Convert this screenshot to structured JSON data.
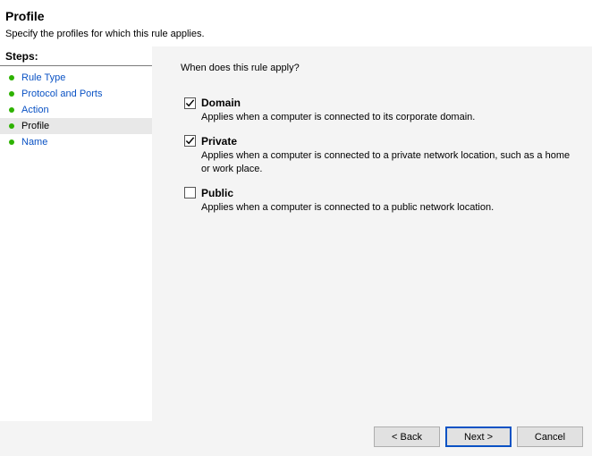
{
  "header": {
    "title": "Profile",
    "subtitle": "Specify the profiles for which this rule applies."
  },
  "sidebar": {
    "heading": "Steps:",
    "items": [
      {
        "label": "Rule Type",
        "current": false
      },
      {
        "label": "Protocol and Ports",
        "current": false
      },
      {
        "label": "Action",
        "current": false
      },
      {
        "label": "Profile",
        "current": true
      },
      {
        "label": "Name",
        "current": false
      }
    ]
  },
  "content": {
    "question": "When does this rule apply?",
    "options": [
      {
        "key": "domain",
        "label": "Domain",
        "checked": true,
        "description": "Applies when a computer is connected to its corporate domain."
      },
      {
        "key": "private",
        "label": "Private",
        "checked": true,
        "description": "Applies when a computer is connected to a private network location, such as a home or work place."
      },
      {
        "key": "public",
        "label": "Public",
        "checked": false,
        "description": "Applies when a computer is connected to a public network location."
      }
    ]
  },
  "footer": {
    "back": "< Back",
    "next": "Next >",
    "cancel": "Cancel"
  }
}
